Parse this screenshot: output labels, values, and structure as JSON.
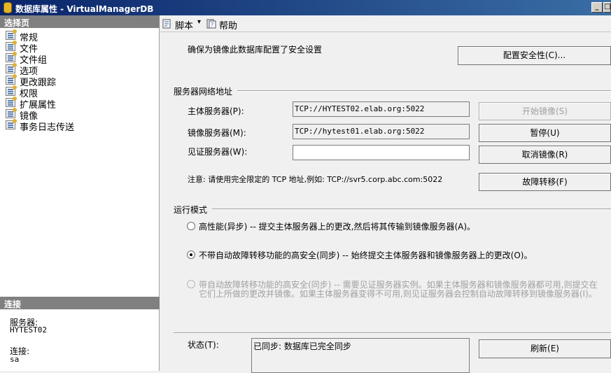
{
  "window": {
    "title": "数据库属性 - VirtualManagerDB",
    "min_label": "_",
    "max_label": "□"
  },
  "left": {
    "select_page_header": "选择页",
    "nav_items": [
      {
        "label": "常规"
      },
      {
        "label": "文件"
      },
      {
        "label": "文件组"
      },
      {
        "label": "选项"
      },
      {
        "label": "更改跟踪"
      },
      {
        "label": "权限"
      },
      {
        "label": "扩展属性"
      },
      {
        "label": "镜像"
      },
      {
        "label": "事务日志传送"
      }
    ],
    "connection_header": "连接",
    "server_label": "服务器:",
    "server_value": "HYTEST02",
    "connection_label": "连接:",
    "connection_value": "sa"
  },
  "toolbar": {
    "script_label": "脚本",
    "dropdown_arrow": "▾",
    "help_label": "帮助"
  },
  "main": {
    "security_text": "确保为镜像此数据库配置了安全设置",
    "configure_security_button": "配置安全性(C)...",
    "network_section": "服务器网络地址",
    "principal_label": "主体服务器(P):",
    "principal_value": "TCP://HYTEST02.elab.org:5022",
    "mirror_label": "镜像服务器(M):",
    "mirror_value": "TCP://hytest01.elab.org:5022",
    "witness_label": "见证服务器(W):",
    "witness_value": "",
    "start_mirroring_button": "开始镜像(S)",
    "pause_button": "暂停(U)",
    "remove_mirroring_button": "取消镜像(R)",
    "failover_button": "故障转移(F)",
    "note_text": "注意: 请使用完全限定的 TCP 地址,例如: TCP://svr5.corp.abc.com:5022",
    "mode_section": "运行模式",
    "mode_high_performance": "高性能(异步) -- 提交主体服务器上的更改,然后将其传输到镜像服务器(A)。",
    "mode_high_safety": "不带自动故障转移功能的高安全(同步) -- 始终提交主体服务器和镜像服务器上的更改(O)。",
    "mode_auto_failover_line1": "带自动故障转移功能的高安全(同步) -- 需要见证服务器实例。如果主体服务器和镜像服务器都可用,则提交在",
    "mode_auto_failover_line2": "它们上所做的更改并镜像。如果主体服务器变得不可用,则见证服务器会控制自动故障转移到镜像服务器(I)。",
    "selected_mode": "high_safety",
    "status_label": "状态(T):",
    "status_value": "已同步: 数据库已完全同步",
    "refresh_button": "刷新(E)"
  },
  "colors": {
    "title_bar": "#0a246a",
    "panel_header": "#808080",
    "disabled_text": "#a0a0a0"
  }
}
